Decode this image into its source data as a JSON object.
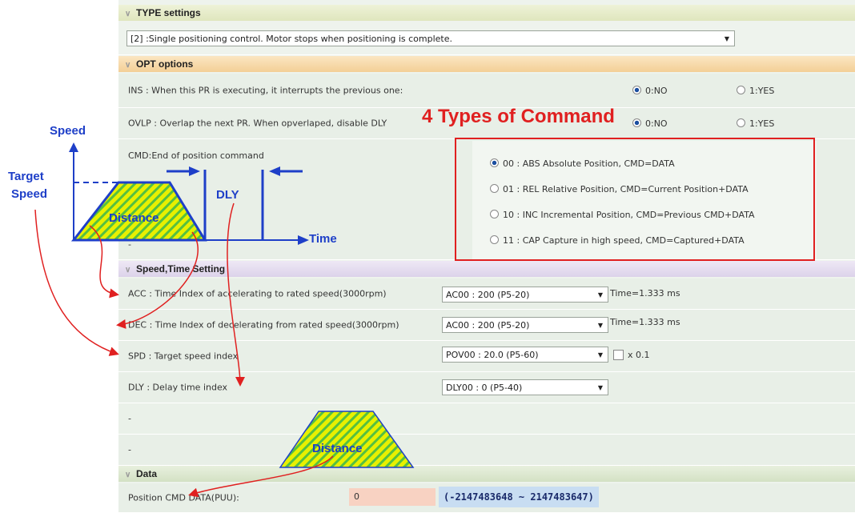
{
  "type_settings": {
    "header": "TYPE settings",
    "selected_option": "[2] :Single positioning control.  Motor stops when positioning is complete."
  },
  "opt_options": {
    "header": "OPT options",
    "ins": {
      "label": "INS : When this PR is executing, it interrupts the previous one:",
      "opt_no": "0:NO",
      "opt_yes": "1:YES"
    },
    "ovlp": {
      "label": "OVLP : Overlap the next PR. When opverlaped, disable DLY",
      "opt_no": "0:NO",
      "opt_yes": "1:YES"
    },
    "cmd": {
      "label": "CMD:End of position command",
      "options": [
        "00 : ABS Absolute Position, CMD=DATA",
        "01 : REL Relative Position, CMD=Current Position+DATA",
        "10 : INC Incremental Position, CMD=Previous CMD+DATA",
        "11 : CAP Capture in high speed, CMD=Captured+DATA"
      ]
    },
    "dash_row": "-"
  },
  "speed_time": {
    "header": "Speed,Time Setting",
    "acc": {
      "label": "ACC : Time Index of accelerating to rated speed(3000rpm)",
      "value": "AC00 : 200 (P5-20)",
      "note": "Time=1.333 ms"
    },
    "dec": {
      "label": "DEC : Time Index of decelerating from rated speed(3000rpm)",
      "value": "AC00 : 200 (P5-20)",
      "note": "Time=1.333 ms"
    },
    "spd": {
      "label": "SPD : Target speed index",
      "value": "POV00 : 20.0 (P5-60)",
      "checkbox_label": "x 0.1"
    },
    "dly": {
      "label": "DLY : Delay time index",
      "value": "DLY00 : 0 (P5-40)"
    },
    "dash1": "-",
    "dash2": "-"
  },
  "data_section": {
    "header": "Data",
    "position_label": "Position CMD DATA(PUU):",
    "position_value": "0",
    "range": "(-2147483648 ~ 2147483647)"
  },
  "annotations": {
    "title": "4 Types of Command",
    "speed": "Speed",
    "target_speed_line1": "Target",
    "target_speed_line2": "Speed",
    "time": "Time",
    "dly": "DLY",
    "distance": "Distance",
    "distance2": "Distance"
  },
  "colors": {
    "annotation_red": "#e02020",
    "annotation_blue": "#1e3fc8",
    "hatch_yellow": "#e8f000",
    "hatch_green": "#55c040",
    "opt_header": "#f6d8a8",
    "type_header": "#e6ecc8",
    "speed_header": "#e6def0",
    "data_header": "#dde8d0"
  }
}
